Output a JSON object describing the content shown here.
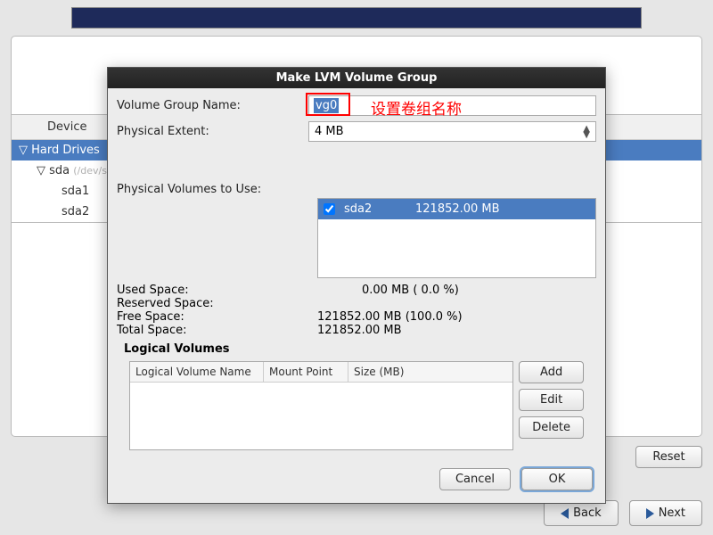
{
  "dialog": {
    "title": "Make LVM Volume Group",
    "vg_label": "Volume Group Name:",
    "vg_value": "vg0",
    "annotation": "设置卷组名称",
    "pe_label": "Physical Extent:",
    "pe_value": "4 MB",
    "pv_label": "Physical Volumes to Use:",
    "pv_items": [
      {
        "checked": true,
        "name": "sda2",
        "size": "121852.00 MB"
      }
    ],
    "stats": {
      "used_lbl": "Used Space:",
      "used_val": "0.00 MB  ( 0.0 %)",
      "reserved_lbl": "Reserved Space:",
      "reserved_val": "",
      "free_lbl": "Free Space:",
      "free_val": "121852.00 MB  (100.0 %)",
      "total_lbl": "Total Space:",
      "total_val": "121852.00 MB"
    },
    "lv_heading": "Logical Volumes",
    "lv_cols": {
      "name": "Logical Volume Name",
      "mount": "Mount Point",
      "size": "Size (MB)"
    },
    "btns": {
      "add": "Add",
      "edit": "Edit",
      "delete": "Delete",
      "cancel": "Cancel",
      "ok": "OK"
    }
  },
  "tree": {
    "header": "Device",
    "hd": "Hard Drives",
    "sda": "sda",
    "sda_dev": "(/dev/sd",
    "sda1": "sda1",
    "sda2": "sda2"
  },
  "footer": {
    "reset": "Reset",
    "back": "Back",
    "next": "Next"
  }
}
